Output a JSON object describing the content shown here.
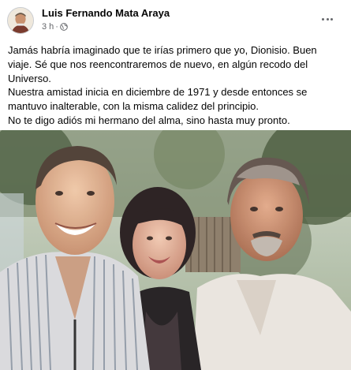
{
  "post": {
    "author": "Luis Fernando Mata Araya",
    "time": "3 h",
    "separator": "·",
    "privacy_icon": "globe-icon",
    "more_icon": "more-horizontal-icon",
    "text_lines": [
      "Jamás habría imaginado que te irías primero que yo, Dionisio. Buen viaje. Sé que nos reencontraremos de nuevo, en algún recodo del Universo.",
      "Nuestra amistad inicia en diciembre de 1971 y desde entonces se mantuvo inalterable, con la misma calidez del principio.",
      "No te digo adiós mi hermano del alma, sino hasta muy pronto."
    ]
  },
  "colors": {
    "text": "#050505",
    "secondary_text": "#65676b"
  }
}
